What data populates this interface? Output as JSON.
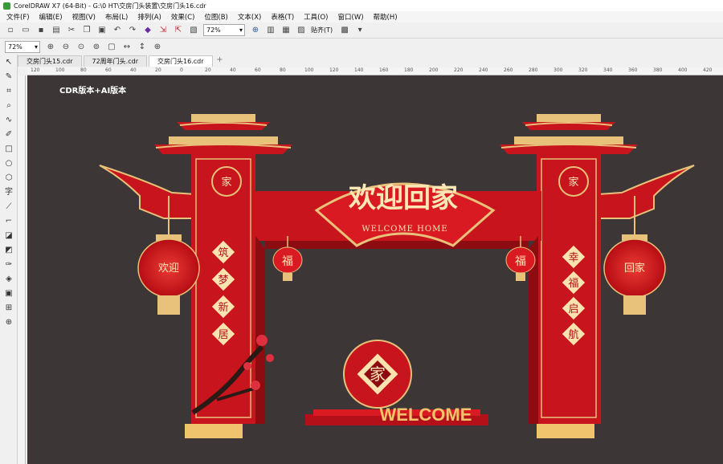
{
  "window": {
    "title": "CorelDRAW X7 (64-Bit) - G:\\0 HT\\交房门头装置\\交房门头16.cdr"
  },
  "menu": [
    "文件(F)",
    "编辑(E)",
    "视图(V)",
    "布局(L)",
    "排列(A)",
    "效果(C)",
    "位图(B)",
    "文本(X)",
    "表格(T)",
    "工具(O)",
    "窗口(W)",
    "帮助(H)"
  ],
  "toolbar": {
    "zoom": "72%",
    "snap_label": "贴齐(T)"
  },
  "property_bar": {
    "zoom": "72%"
  },
  "tabs": [
    "交房门头15.cdr",
    "72周年门头.cdr",
    "交房门头16.cdr"
  ],
  "ruler_ticks": [
    "120",
    "100",
    "80",
    "60",
    "40",
    "20",
    "0",
    "20",
    "40",
    "60",
    "80",
    "100",
    "120",
    "140",
    "160",
    "180",
    "200",
    "220",
    "240",
    "260",
    "280",
    "300",
    "320",
    "340",
    "360",
    "380",
    "400",
    "420"
  ],
  "canvas": {
    "version_label": "CDR版本+AI版本",
    "arch": {
      "title": "欢迎回家",
      "subtitle": "WELCOME HOME",
      "left_couplet": [
        "筑",
        "梦",
        "新",
        "居"
      ],
      "right_couplet": [
        "幸",
        "福",
        "启",
        "航"
      ],
      "left_lantern": "欢迎",
      "right_lantern": "回家",
      "small_lantern_text": "福",
      "medallion_text": "家",
      "center_emblem": "家",
      "welcome_text": "WELCOME"
    },
    "colors": {
      "red": "#c8141c",
      "dark_red": "#8c0c12",
      "gold": "#e8c27a",
      "background": "#3d3637"
    }
  }
}
